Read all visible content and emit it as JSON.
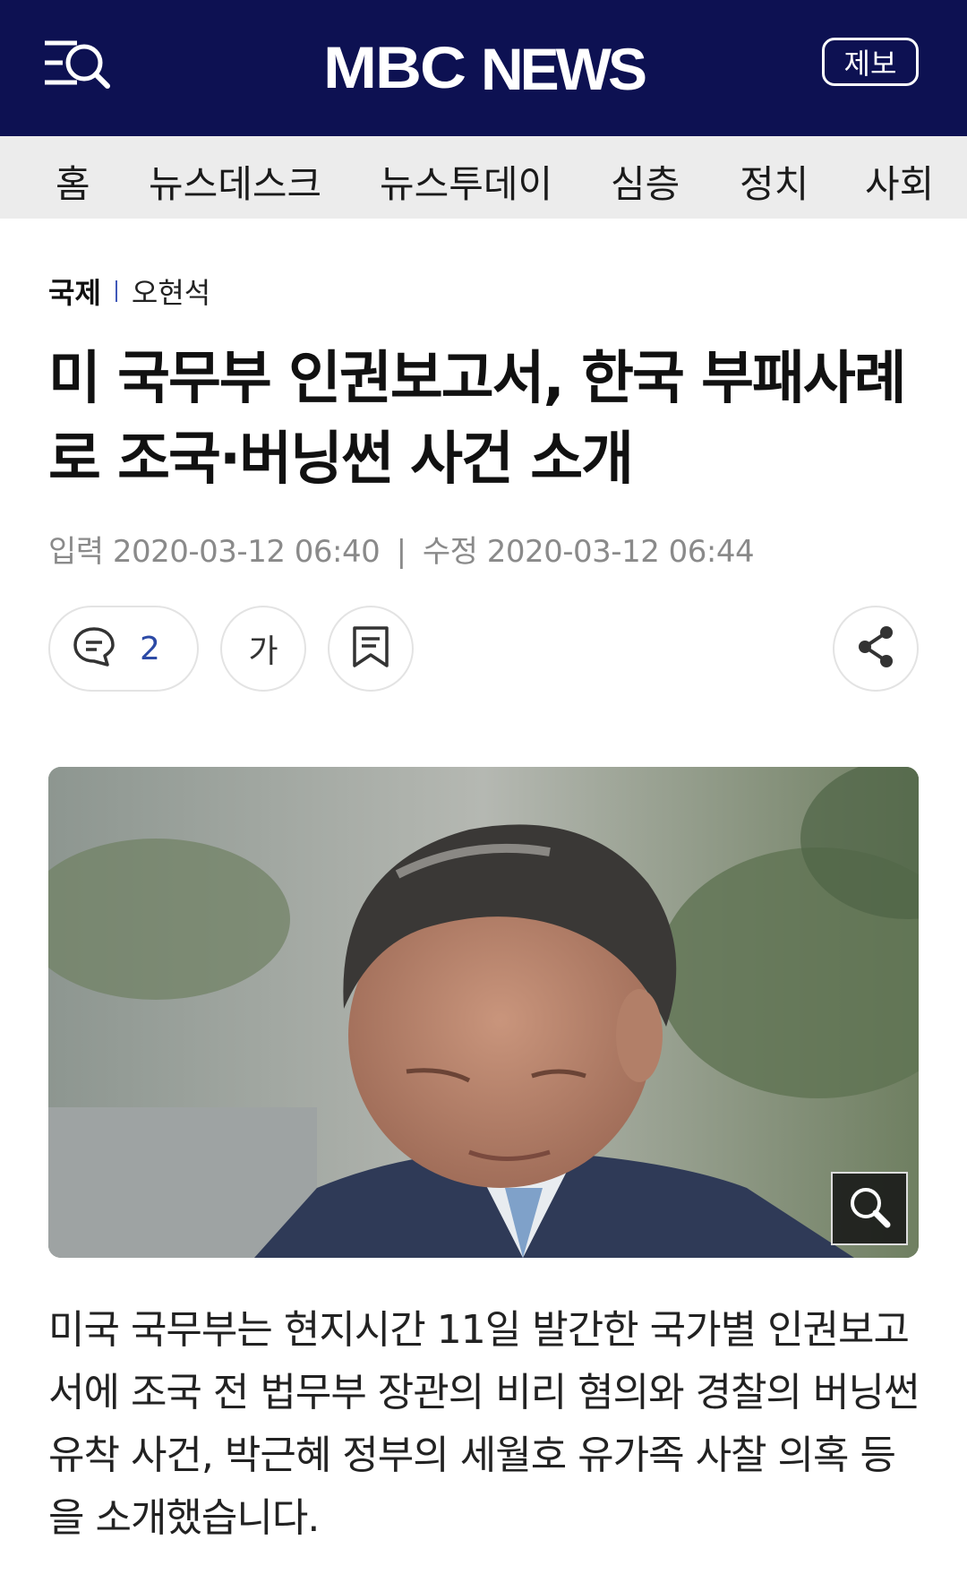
{
  "header": {
    "logo_mbc": "MBC",
    "logo_news": "NEWS",
    "report_label": "제보"
  },
  "nav": {
    "items": [
      "홈",
      "뉴스데스크",
      "뉴스투데이",
      "심층",
      "정치",
      "사회"
    ]
  },
  "article": {
    "category": "국제",
    "reporter": "오현석",
    "headline_line1": "미 국무부 인권보고서, 한국 부패사례",
    "headline_line2": "로 조국·버닝썬 사건 소개",
    "published_label": "입력",
    "published": "2020-03-12 06:40",
    "divider": "|",
    "modified_label": "수정",
    "modified": "2020-03-12 06:44",
    "comment_count": "2",
    "font_size_label": "가",
    "body": "미국 국무부는 현지시간 11일 발간한 국가별 인권보고서에 조국 전 법무부 장관의 비리 혐의와 경찰의 버닝썬 유착 사건, 박근혜 정부의 세월호 유가족 사찰 의혹 등을 소개했습니다."
  },
  "colors": {
    "header_bg": "#0d1152",
    "accent": "#2c4aa6",
    "nav_bg": "#ececec"
  },
  "icons": [
    "menu-search-icon",
    "comment-icon",
    "bookmark-icon",
    "share-icon",
    "zoom-icon"
  ]
}
